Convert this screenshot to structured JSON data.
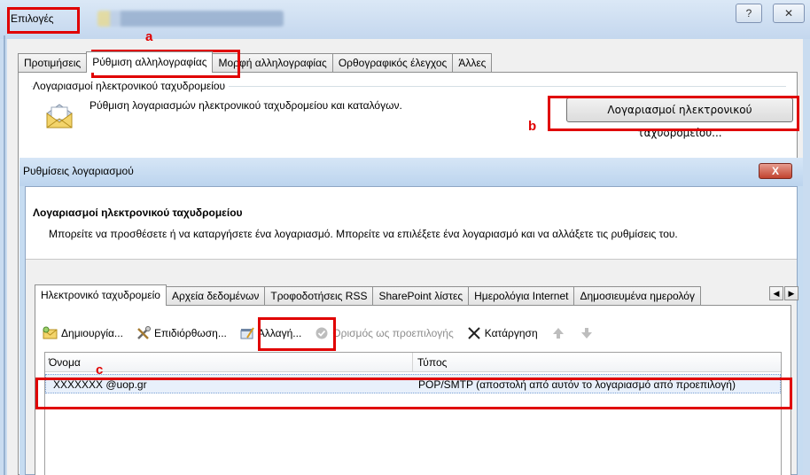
{
  "outer_window": {
    "title": "Επιλογές",
    "help_glyph": "?",
    "close_glyph": "✕",
    "tabs": [
      {
        "label": "Προτιμήσεις",
        "active": false
      },
      {
        "label": "Ρύθμιση αλληλογραφίας",
        "active": true
      },
      {
        "label": "Μορφή αλληλογραφίας",
        "active": false
      },
      {
        "label": "Ορθογραφικός έλεγχος",
        "active": false
      },
      {
        "label": "Άλλες",
        "active": false
      }
    ],
    "group_title": "Λογαριασμοί ηλεκτρονικού ταχυδρομείου",
    "group_description": "Ρύθμιση λογαριασμών ηλεκτρονικού ταχυδρομείου και καταλόγων.",
    "accounts_button": "Λογαριασμοί ηλεκτρονικού ταχυδρομείου..."
  },
  "dialog": {
    "title": "Ρυθμίσεις λογαριασμού",
    "close_glyph": "X",
    "header_title": "Λογαριασμοί ηλεκτρονικού ταχυδρομείου",
    "header_desc": "Μπορείτε να προσθέσετε ή να καταργήσετε ένα λογαριασμό. Μπορείτε να επιλέξετε ένα λογαριασμό και να αλλάξετε τις ρυθμίσεις του.",
    "tabs": [
      {
        "label": "Ηλεκτρονικό ταχυδρομείο",
        "active": true
      },
      {
        "label": "Αρχεία δεδομένων",
        "active": false
      },
      {
        "label": "Τροφοδοτήσεις RSS",
        "active": false
      },
      {
        "label": "SharePoint λίστες",
        "active": false
      },
      {
        "label": "Ημερολόγια Internet",
        "active": false
      },
      {
        "label": "Δημοσιευμένα ημερολόγ",
        "active": false
      }
    ],
    "tab_scroll_left": "◀",
    "tab_scroll_right": "▶",
    "toolbar": {
      "new": "Δημιουργία...",
      "repair": "Επιδιόρθωση...",
      "change": "Αλλαγή...",
      "set_default": "Ορισμός ως προεπιλογής",
      "remove": "Κατάργηση"
    },
    "list": {
      "col_name": "Όνομα",
      "col_type": "Τύπος",
      "rows": [
        {
          "name": "XXXXXXX @uop.gr",
          "type": "POP/SMTP (αποστολή από αυτόν το λογαριασμό από προεπιλογή)"
        }
      ]
    }
  },
  "annotations": {
    "a": "a",
    "b": "b",
    "c": "c",
    "color": "#e00000"
  }
}
